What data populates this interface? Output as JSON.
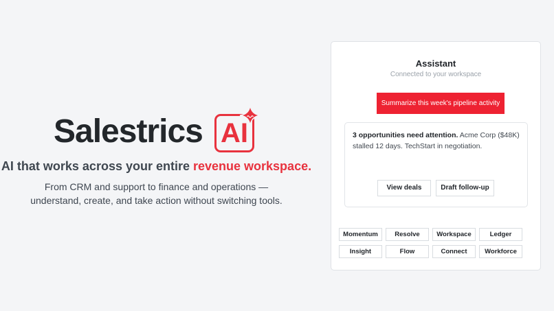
{
  "hero": {
    "logo_word": "Salestrics",
    "logo_badge": "AI",
    "tagline_prefix": "AI that works across your entire ",
    "tagline_accent": "revenue workspace.",
    "subtext_line1": "From CRM and support to finance and operations —",
    "subtext_line2": "understand, create, and take action without switching tools."
  },
  "assistant": {
    "title": "Assistant",
    "subtitle": "Connected to your workspace",
    "prompt_button": "Summarize this week's pipeline activity",
    "answer": {
      "headline": "3 opportunities need attention.",
      "body": " Acme Corp ($48K) stalled 12 days. TechStart in negotiation.",
      "view_button": "View deals",
      "draft_button": "Draft follow-up"
    },
    "chips": [
      "Momentum",
      "Resolve",
      "Workspace",
      "Ledger",
      "Insight",
      "Flow",
      "Connect",
      "Workforce"
    ]
  },
  "colors": {
    "accent": "#ee2232",
    "background": "#f4f5f7",
    "text": "#1f2328"
  }
}
